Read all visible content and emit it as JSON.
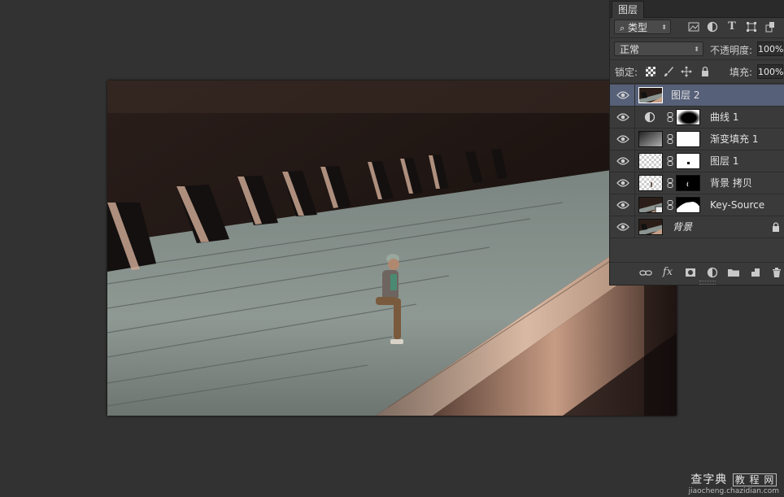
{
  "panel": {
    "tab_title": "图层",
    "filter": {
      "label": "类型",
      "icons": [
        "search-icon",
        "image-filter-icon",
        "adjustment-filter-icon",
        "type-filter-icon",
        "shape-filter-icon",
        "smart-object-filter-icon"
      ]
    },
    "blend_mode": "正常",
    "opacity_label": "不透明度:",
    "opacity_value": "100%",
    "lock_label": "锁定:",
    "fill_label": "填充:",
    "fill_value": "100%",
    "layers": [
      {
        "name": "图层 2",
        "selected": true,
        "visible": true
      },
      {
        "name": "曲线 1",
        "selected": false,
        "visible": true
      },
      {
        "name": "渐变填充 1",
        "selected": false,
        "visible": true
      },
      {
        "name": "图层 1",
        "selected": false,
        "visible": true
      },
      {
        "name": "背景 拷贝",
        "selected": false,
        "visible": true
      },
      {
        "name": "Key-Source",
        "selected": false,
        "visible": true
      },
      {
        "name": "背景",
        "selected": false,
        "visible": true,
        "locked": true
      }
    ],
    "bottom_icons": [
      "link-layers-icon",
      "fx-icon",
      "add-mask-icon",
      "new-adjustment-icon",
      "new-group-icon",
      "new-layer-icon",
      "delete-layer-icon"
    ],
    "fx_label": "fx"
  },
  "watermark": {
    "line1": "查字典",
    "line1_box": "教 程 网",
    "line2": "jiaocheng.chazidian.com"
  },
  "colors": {
    "selected_layer": "#566078",
    "panel_bg": "#3a3a3a",
    "workspace_bg": "#323232"
  }
}
